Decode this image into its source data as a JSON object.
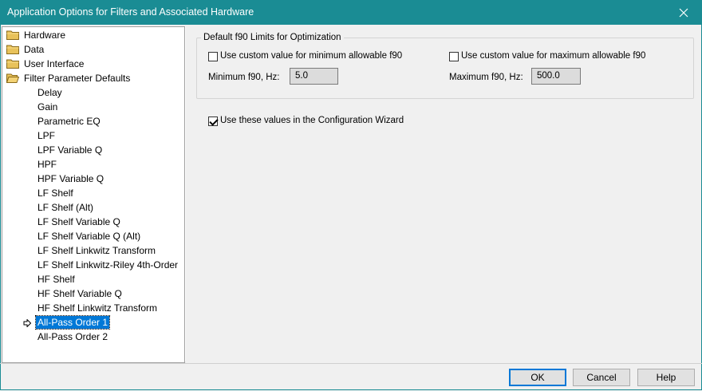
{
  "window": {
    "title": "Application Options for Filters and Associated Hardware",
    "close_glyph": "✕"
  },
  "tree": {
    "folders": [
      {
        "label": "Hardware"
      },
      {
        "label": "Data"
      },
      {
        "label": "User Interface"
      },
      {
        "label": "Filter Parameter Defaults"
      }
    ],
    "children": [
      {
        "label": "Delay"
      },
      {
        "label": "Gain"
      },
      {
        "label": "Parametric EQ"
      },
      {
        "label": "LPF"
      },
      {
        "label": "LPF Variable Q"
      },
      {
        "label": "HPF"
      },
      {
        "label": "HPF Variable Q"
      },
      {
        "label": "LF Shelf"
      },
      {
        "label": "LF Shelf (Alt)"
      },
      {
        "label": "LF Shelf Variable Q"
      },
      {
        "label": "LF Shelf Variable Q (Alt)"
      },
      {
        "label": "LF Shelf Linkwitz Transform"
      },
      {
        "label": "LF Shelf Linkwitz-Riley 4th-Order"
      },
      {
        "label": "HF Shelf"
      },
      {
        "label": "HF Shelf Variable Q"
      },
      {
        "label": "HF Shelf Linkwitz Transform"
      },
      {
        "label": "All-Pass Order 1"
      },
      {
        "label": "All-Pass Order 2"
      }
    ],
    "selected": "All-Pass Order 1"
  },
  "group": {
    "title": "Default f90 Limits for Optimization",
    "min_checkbox_label": "Use custom value for minimum allowable f90",
    "min_checked": false,
    "max_checkbox_label": "Use custom value for maximum allowable f90",
    "max_checked": false,
    "min_label": "Minimum f90, Hz:",
    "min_value": "5.0",
    "max_label": "Maximum f90, Hz:",
    "max_value": "500.0"
  },
  "wizard": {
    "label": "Use these values in the Configuration Wizard",
    "checked": true
  },
  "buttons": {
    "ok": "OK",
    "cancel": "Cancel",
    "help": "Help"
  }
}
